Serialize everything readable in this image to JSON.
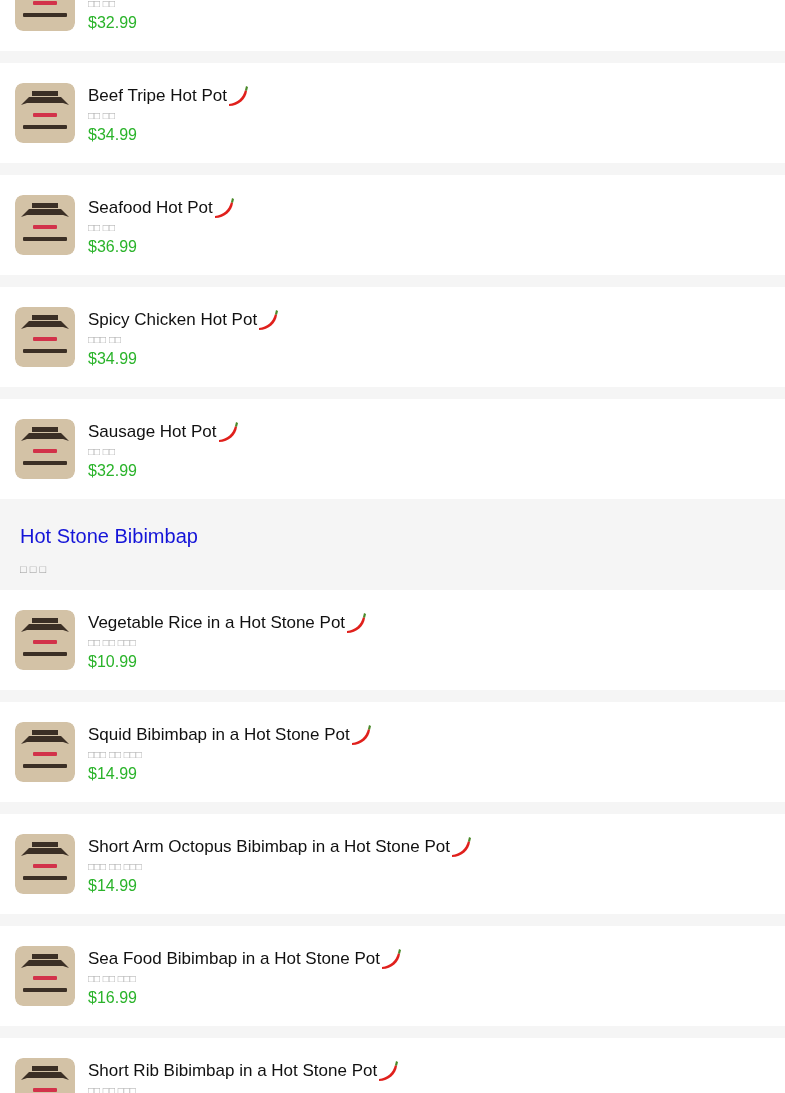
{
  "sections": [
    {
      "items": [
        {
          "subtitle": "□□ □□",
          "price": "$32.99"
        },
        {
          "name": "Beef Tripe Hot Pot",
          "subtitle": "□□ □□",
          "price": "$34.99",
          "spicy": true
        },
        {
          "name": "Seafood Hot Pot",
          "subtitle": "□□ □□",
          "price": "$36.99",
          "spicy": true
        },
        {
          "name": "Spicy Chicken Hot Pot",
          "subtitle": "□□□ □□",
          "price": "$34.99",
          "spicy": true
        },
        {
          "name": "Sausage Hot Pot",
          "subtitle": "□□ □□",
          "price": "$32.99",
          "spicy": true
        }
      ]
    },
    {
      "title": "Hot Stone Bibimbap",
      "subtitle": "□ □ □",
      "items": [
        {
          "name": "Vegetable Rice in a Hot Stone Pot",
          "subtitle": "□□ □□ □□□",
          "price": "$10.99",
          "spicy": true
        },
        {
          "name": "Squid Bibimbap in a Hot Stone Pot",
          "subtitle": "□□□ □□ □□□",
          "price": "$14.99",
          "spicy": true
        },
        {
          "name": "Short Arm Octopus Bibimbap in a Hot Stone Pot",
          "subtitle": "□□□ □□ □□□",
          "price": "$14.99",
          "spicy": true
        },
        {
          "name": "Sea Food Bibimbap in a Hot Stone Pot",
          "subtitle": "□□ □□ □□□",
          "price": "$16.99",
          "spicy": true
        },
        {
          "name": "Short Rib Bibimbap in a Hot Stone Pot",
          "subtitle": "□□ □□ □□□",
          "spicy": true
        }
      ]
    }
  ]
}
